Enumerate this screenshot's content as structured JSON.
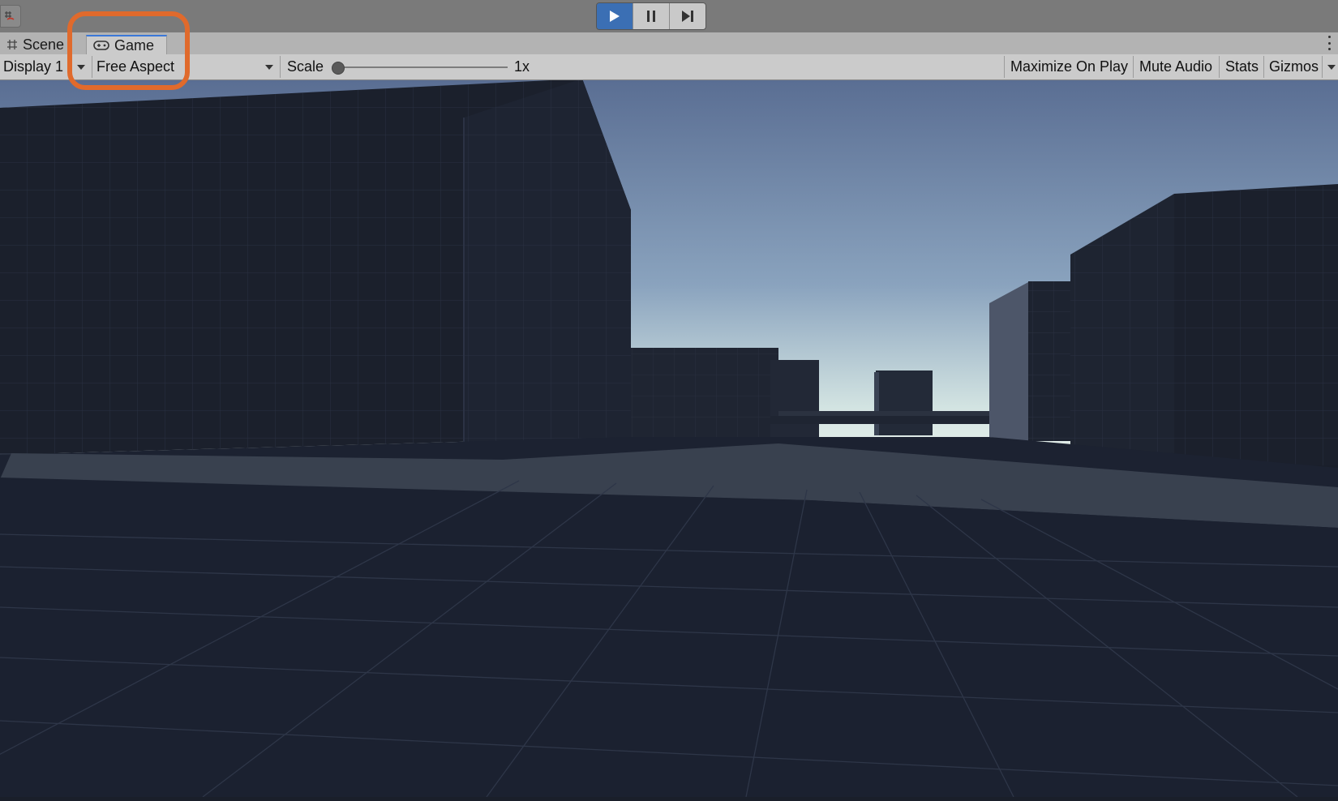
{
  "tabs": [
    {
      "label": "Scene",
      "icon": "grid-icon"
    },
    {
      "label": "Game",
      "icon": "gamepad-icon",
      "active": true
    }
  ],
  "playback": {
    "play_icon": "play-icon",
    "pause_icon": "pause-icon",
    "step_icon": "step-icon",
    "playing": true
  },
  "toolbar": {
    "display": "Display 1",
    "aspect": "Free Aspect",
    "scale_label": "Scale",
    "scale_value": "1x",
    "scale_fraction": 0.0,
    "maximize_on_play": "Maximize On Play",
    "mute_audio": "Mute Audio",
    "stats": "Stats",
    "gizmos": "Gizmos"
  },
  "colors": {
    "accent": "#3b6fb4",
    "highlight": "#e06a2c",
    "sky_top": "#5a6e93",
    "sky_horizon": "#d3e4e2",
    "ground": "#1c2231"
  }
}
